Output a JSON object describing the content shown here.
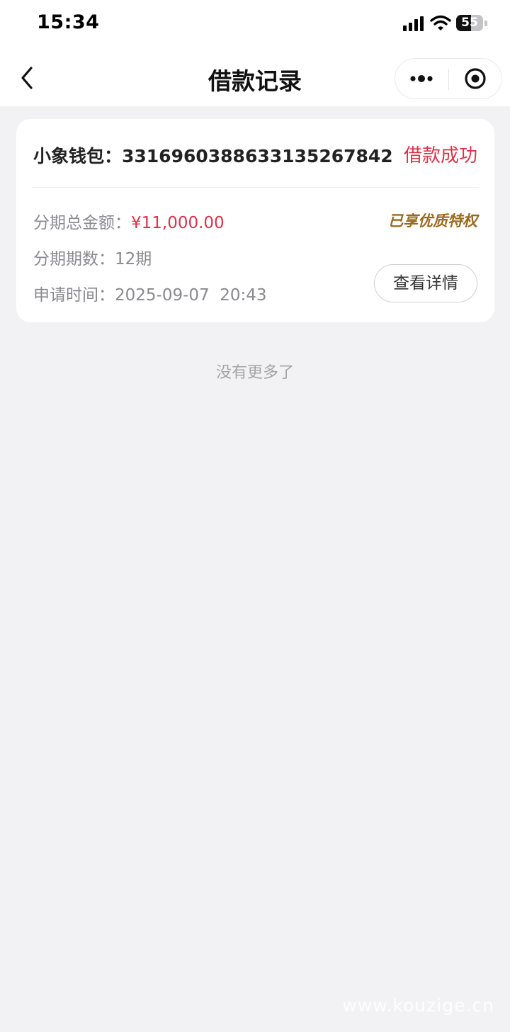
{
  "status_bar": {
    "time": "15:34",
    "battery_level": "55",
    "battery_fraction": 0.55
  },
  "nav": {
    "title": "借款记录",
    "back_icon": "chevron-left-icon",
    "more_icon": "more-dots-icon",
    "close_icon": "target-circle-icon"
  },
  "loan_card": {
    "title": "小象钱包：3316960388633135267842",
    "status": "借款成功",
    "privilege": "已享优质特权",
    "total_label": "分期总金额：",
    "total_amount": "¥11,000.00",
    "periods_label": "分期期数：",
    "periods_value": "12期",
    "apply_time_label": "申请时间：",
    "apply_time_value": "2025-09-07  20:43",
    "detail_button": "查看详情"
  },
  "footer": {
    "no_more": "没有更多了",
    "watermark": "www.kouzige.cn"
  },
  "colors": {
    "accent_red": "#d8334a",
    "privilege_gold": "#9a6a1c",
    "background": "#f2f2f5"
  }
}
